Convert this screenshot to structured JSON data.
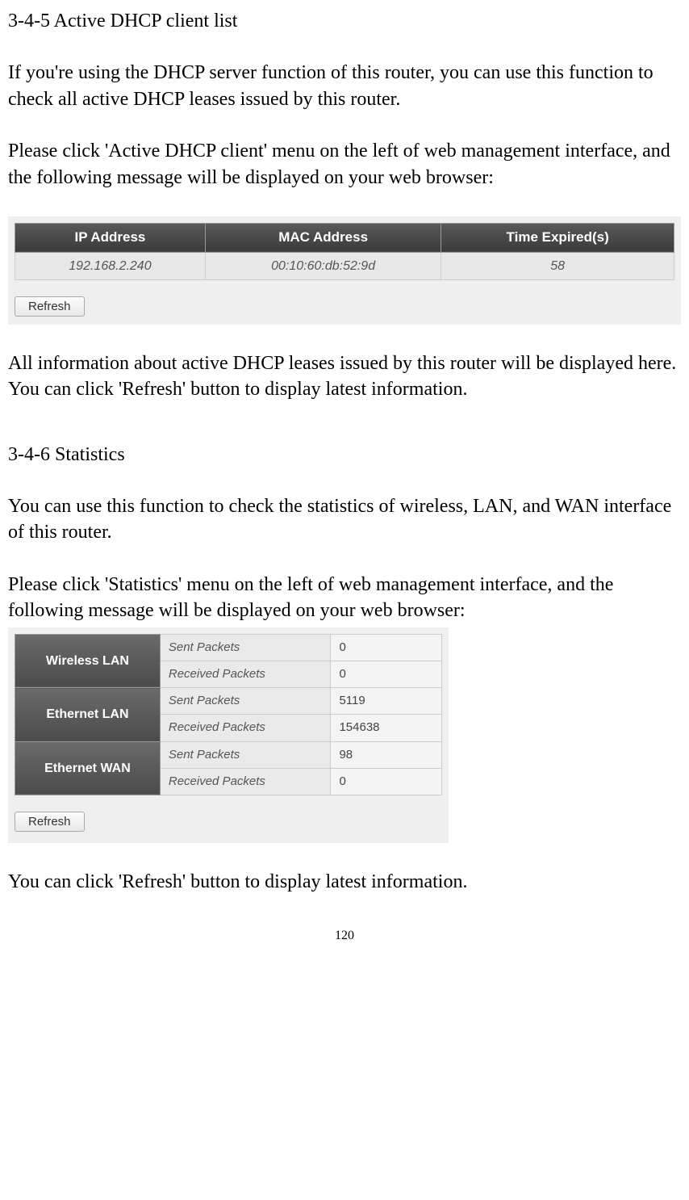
{
  "section1": {
    "heading": "3-4-5 Active DHCP client list",
    "para1": "If you're using the DHCP server function of this router, you can use this function to check all active DHCP leases issued by this router.",
    "para2": "Please click 'Active DHCP client' menu on the left of web management interface, and the following message will be displayed on your web browser:",
    "para3": "All information about active DHCP leases issued by this router will be displayed here. You can click 'Refresh' button to display latest information."
  },
  "dhcp_table": {
    "headers": {
      "ip": "IP Address",
      "mac": "MAC Address",
      "expire": "Time Expired(s)"
    },
    "rows": [
      {
        "ip": "192.168.2.240",
        "mac": "00:10:60:db:52:9d",
        "expire": "58"
      }
    ]
  },
  "section2": {
    "heading": "3-4-6 Statistics",
    "para1": "You can use this function to check the statistics of wireless, LAN, and WAN interface of this router.",
    "para2": "Please click 'Statistics' menu on the left of web management interface, and the following message will be displayed on your web browser:",
    "para3": "You can click 'Refresh' button to display latest information."
  },
  "stats_table": {
    "groups": [
      {
        "name": "Wireless LAN",
        "sent_label": "Sent Packets",
        "sent_value": "0",
        "recv_label": "Received Packets",
        "recv_value": "0"
      },
      {
        "name": "Ethernet LAN",
        "sent_label": "Sent Packets",
        "sent_value": "5119",
        "recv_label": "Received Packets",
        "recv_value": "154638"
      },
      {
        "name": "Ethernet WAN",
        "sent_label": "Sent Packets",
        "sent_value": "98",
        "recv_label": "Received Packets",
        "recv_value": "0"
      }
    ]
  },
  "buttons": {
    "refresh": "Refresh"
  },
  "page_number": "120"
}
